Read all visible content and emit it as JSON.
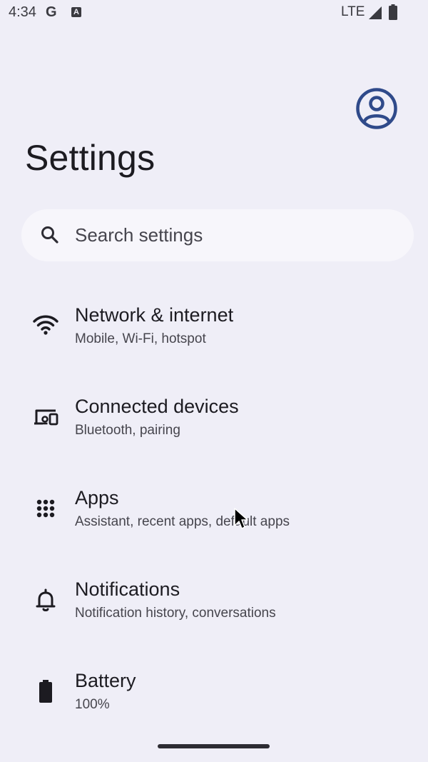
{
  "status_bar": {
    "time": "4:34",
    "google_letter": "G",
    "accessibility_letter": "A",
    "network_type": "LTE"
  },
  "header": {
    "title": "Settings"
  },
  "search": {
    "placeholder": "Search settings"
  },
  "settings_items": [
    {
      "title": "Network & internet",
      "subtitle": "Mobile, Wi-Fi, hotspot",
      "icon": "wifi-icon"
    },
    {
      "title": "Connected devices",
      "subtitle": "Bluetooth, pairing",
      "icon": "connected-devices-icon"
    },
    {
      "title": "Apps",
      "subtitle": "Assistant, recent apps, default apps",
      "icon": "apps-grid-icon"
    },
    {
      "title": "Notifications",
      "subtitle": "Notification history, conversations",
      "icon": "bell-icon"
    },
    {
      "title": "Battery",
      "subtitle": "100%",
      "icon": "battery-icon"
    }
  ],
  "colors": {
    "background": "#efeef7",
    "search_background": "#f7f6fb",
    "accent_profile": "#2f4a8a",
    "text_primary": "#1c1b21",
    "text_secondary": "#46454d"
  }
}
